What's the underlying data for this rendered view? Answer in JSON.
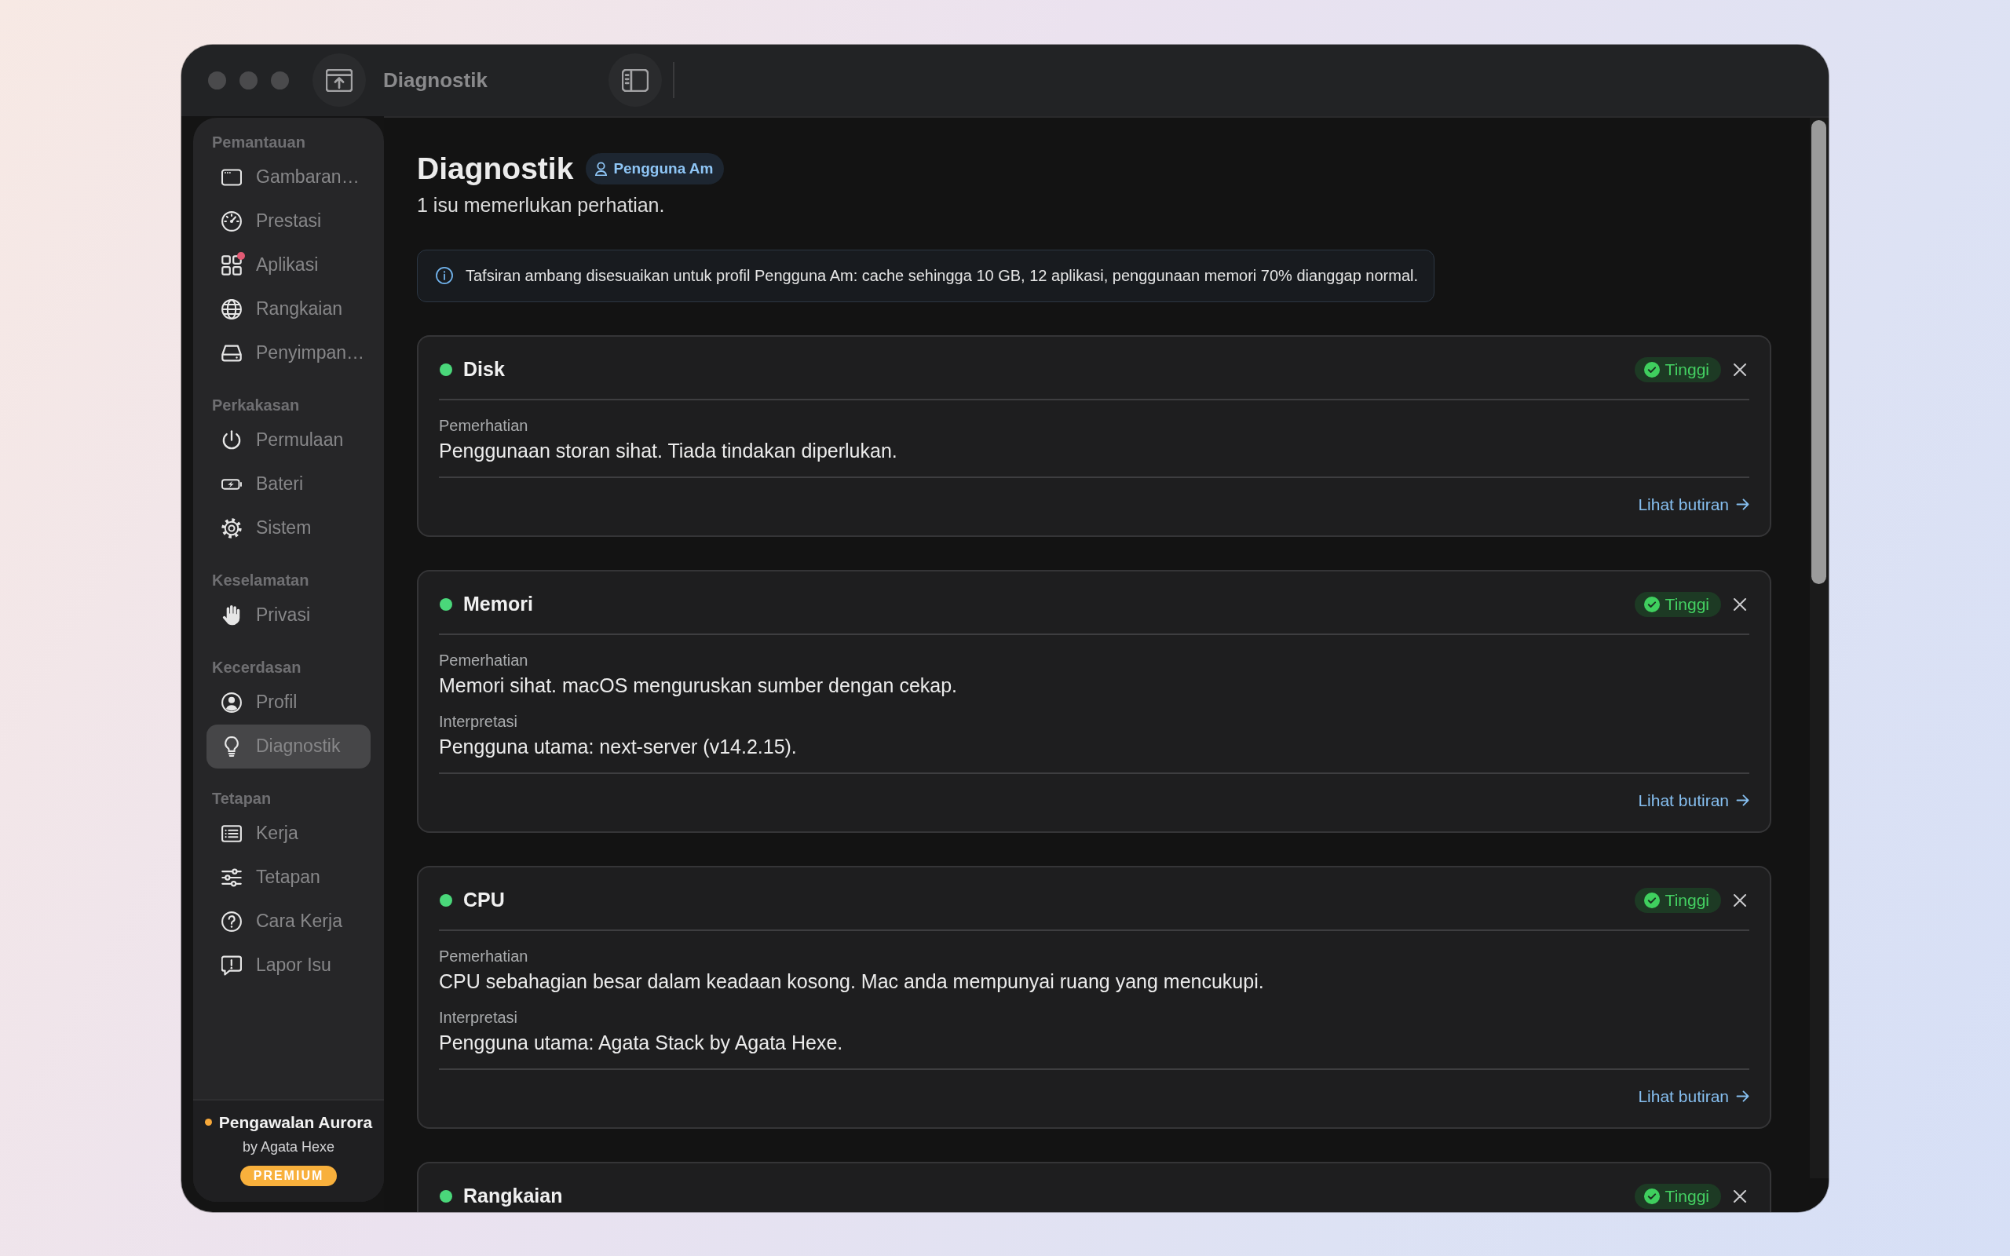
{
  "window": {
    "title": "Diagnostik"
  },
  "sidebar": {
    "sections": [
      {
        "heading": "Pemantauan",
        "items": [
          {
            "label": "Gambaran…",
            "selected": false,
            "alert": false
          },
          {
            "label": "Prestasi",
            "selected": false,
            "alert": false
          },
          {
            "label": "Aplikasi",
            "selected": false,
            "alert": true
          },
          {
            "label": "Rangkaian",
            "selected": false,
            "alert": false
          },
          {
            "label": "Penyimpan…",
            "selected": false,
            "alert": false
          }
        ]
      },
      {
        "heading": "Perkakasan",
        "items": [
          {
            "label": "Permulaan",
            "selected": false,
            "alert": false
          },
          {
            "label": "Bateri",
            "selected": false,
            "alert": false
          },
          {
            "label": "Sistem",
            "selected": false,
            "alert": false
          }
        ]
      },
      {
        "heading": "Keselamatan",
        "items": [
          {
            "label": "Privasi",
            "selected": false,
            "alert": false
          }
        ]
      },
      {
        "heading": "Kecerdasan",
        "items": [
          {
            "label": "Profil",
            "selected": false,
            "alert": false
          },
          {
            "label": "Diagnostik",
            "selected": true,
            "alert": false
          }
        ]
      },
      {
        "heading": "Tetapan",
        "items": [
          {
            "label": "Kerja",
            "selected": false,
            "alert": false
          },
          {
            "label": "Tetapan",
            "selected": false,
            "alert": false
          },
          {
            "label": "Cara Kerja",
            "selected": false,
            "alert": false
          },
          {
            "label": "Lapor Isu",
            "selected": false,
            "alert": false
          }
        ]
      }
    ],
    "footer": {
      "title": "Pengawalan Aurora",
      "byline": "by Agata Hexe",
      "badge": "PREMIUM"
    }
  },
  "header": {
    "title": "Diagnostik",
    "user_type": "Pengguna Am",
    "subtitle": "1 isu memerlukan perhatian."
  },
  "info_banner": {
    "text": "Tafsiran ambang disesuaikan untuk profil Pengguna Am: cache sehingga 10 GB, 12 aplikasi, penggunaan memori 70% dianggap normal."
  },
  "cards": [
    {
      "title": "Disk",
      "color": "#4ad77a",
      "badge": "Tinggi",
      "sections": [
        {
          "label": "Pemerhatian",
          "text": "Penggunaan storan sihat. Tiada tindakan diperlukan."
        }
      ],
      "link": "Lihat butiran"
    },
    {
      "title": "Memori",
      "color": "#4ad77a",
      "badge": "Tinggi",
      "sections": [
        {
          "label": "Pemerhatian",
          "text": "Memori sihat. macOS menguruskan sumber dengan cekap."
        },
        {
          "label": "Interpretasi",
          "text": "Pengguna utama: next-server (v14.2.15)."
        }
      ],
      "link": "Lihat butiran"
    },
    {
      "title": "CPU",
      "color": "#4ad77a",
      "badge": "Tinggi",
      "sections": [
        {
          "label": "Pemerhatian",
          "text": "CPU sebahagian besar dalam keadaan kosong. Mac anda mempunyai ruang yang mencukupi."
        },
        {
          "label": "Interpretasi",
          "text": "Pengguna utama: Agata Stack by Agata Hexe."
        }
      ],
      "link": "Lihat butiran"
    },
    {
      "title": "Rangkaian",
      "color": "#4ad77a",
      "badge": "Tinggi"
    }
  ]
}
